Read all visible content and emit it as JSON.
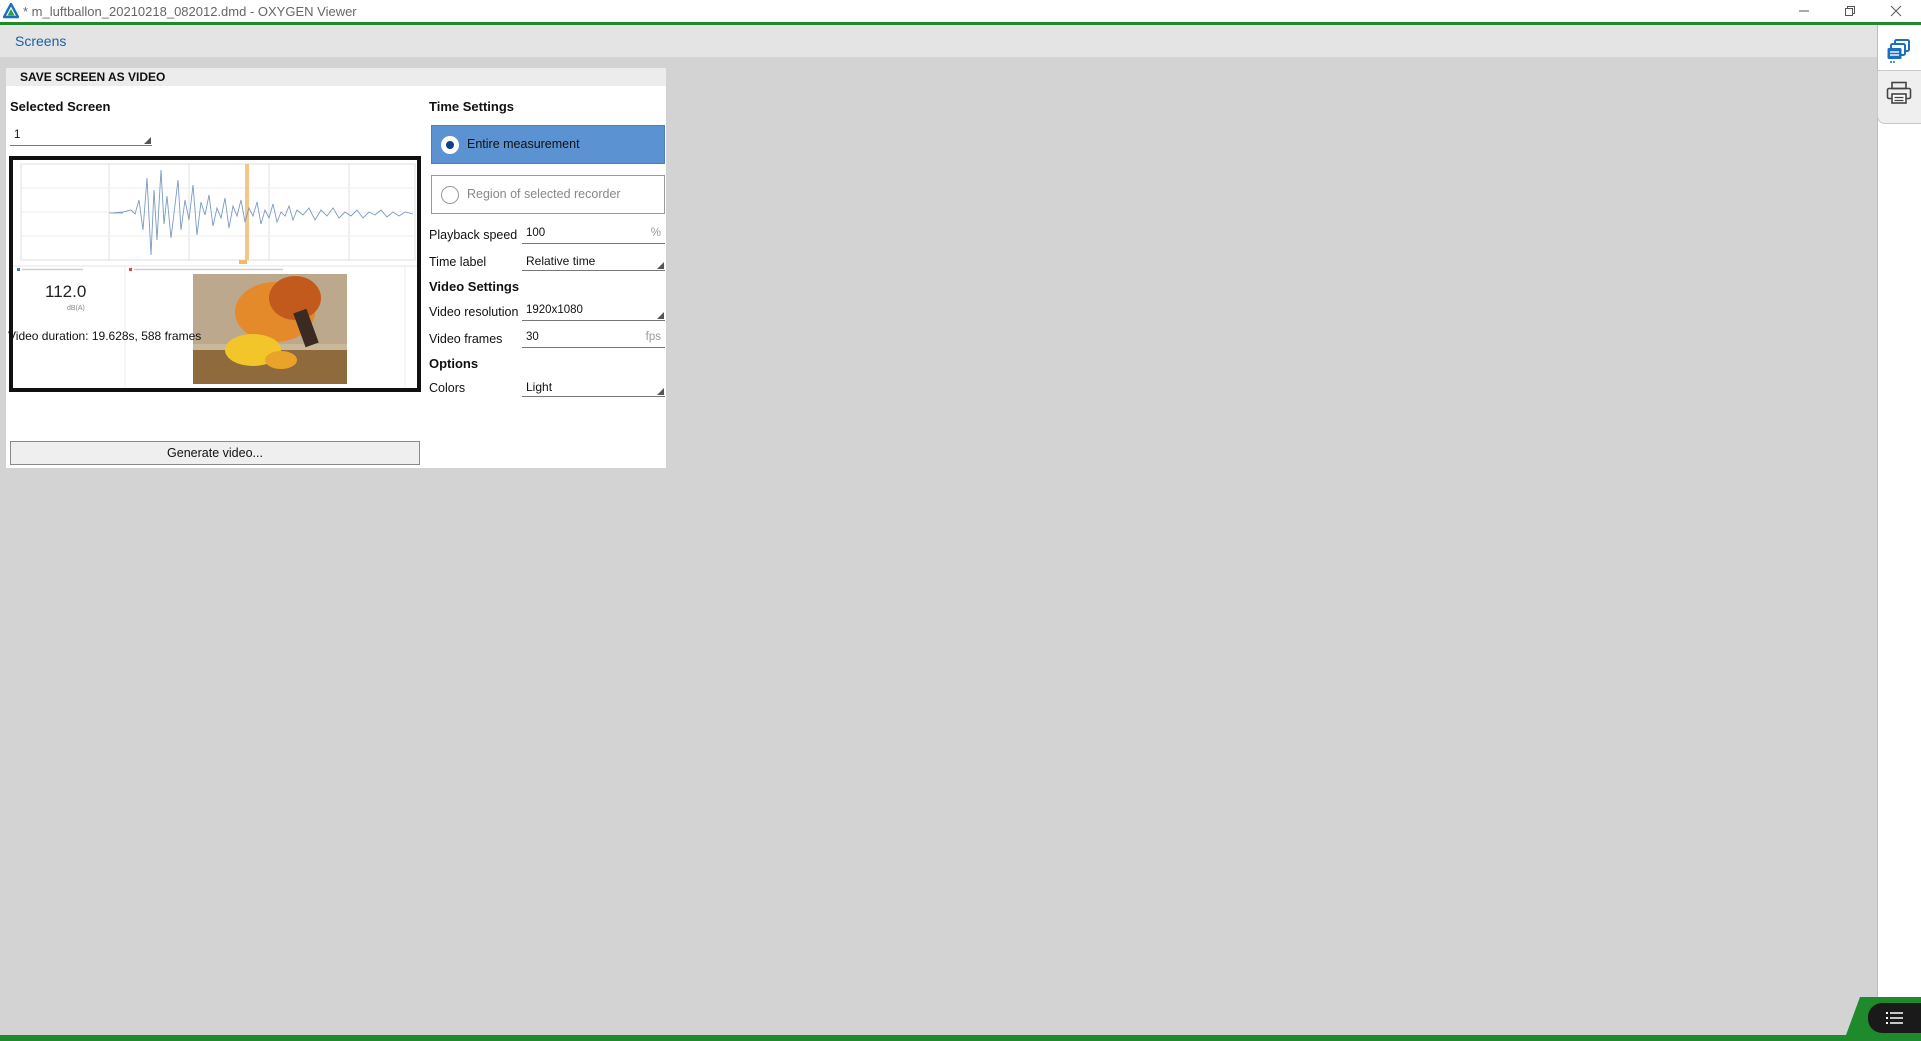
{
  "window": {
    "title": "* m_luftballon_20210218_082012.dmd - OXYGEN Viewer",
    "minimize_glyph": "—",
    "restore_glyph": "❐",
    "close_glyph": "✕"
  },
  "screens_bar": {
    "label": "Screens"
  },
  "panel": {
    "title": "SAVE SCREEN AS VIDEO",
    "selected_screen": {
      "heading": "Selected Screen",
      "value": "1"
    },
    "preview": {
      "meter_value": "112.0",
      "meter_unit": "dB(A)"
    },
    "video_duration": "Video duration: 19.628s, 588 frames",
    "generate_button": "Generate video...",
    "time_settings": {
      "heading": "Time Settings",
      "options": [
        {
          "label": "Entire measurement",
          "selected": true
        },
        {
          "label": "Region of selected recorder",
          "selected": false
        }
      ],
      "playback_speed_label": "Playback speed",
      "playback_speed_value": "100",
      "playback_speed_unit": "%",
      "time_label_label": "Time label",
      "time_label_value": "Relative time"
    },
    "video_settings": {
      "heading": "Video Settings",
      "resolution_label": "Video resolution",
      "resolution_value": "1920x1080",
      "frames_label": "Video frames",
      "frames_value": "30",
      "frames_unit": "fps"
    },
    "options": {
      "heading": "Options",
      "colors_label": "Colors",
      "colors_value": "Light"
    }
  },
  "colors": {
    "accent_green": "#1f8a2c",
    "selected_blue": "#5b92d1",
    "link_blue": "#1b5fa6"
  },
  "icons": {
    "app": "oxygen-logo-icon",
    "sidebar": [
      "screens-stack-icon",
      "print-icon"
    ],
    "bottom": "list-menu-icon"
  }
}
